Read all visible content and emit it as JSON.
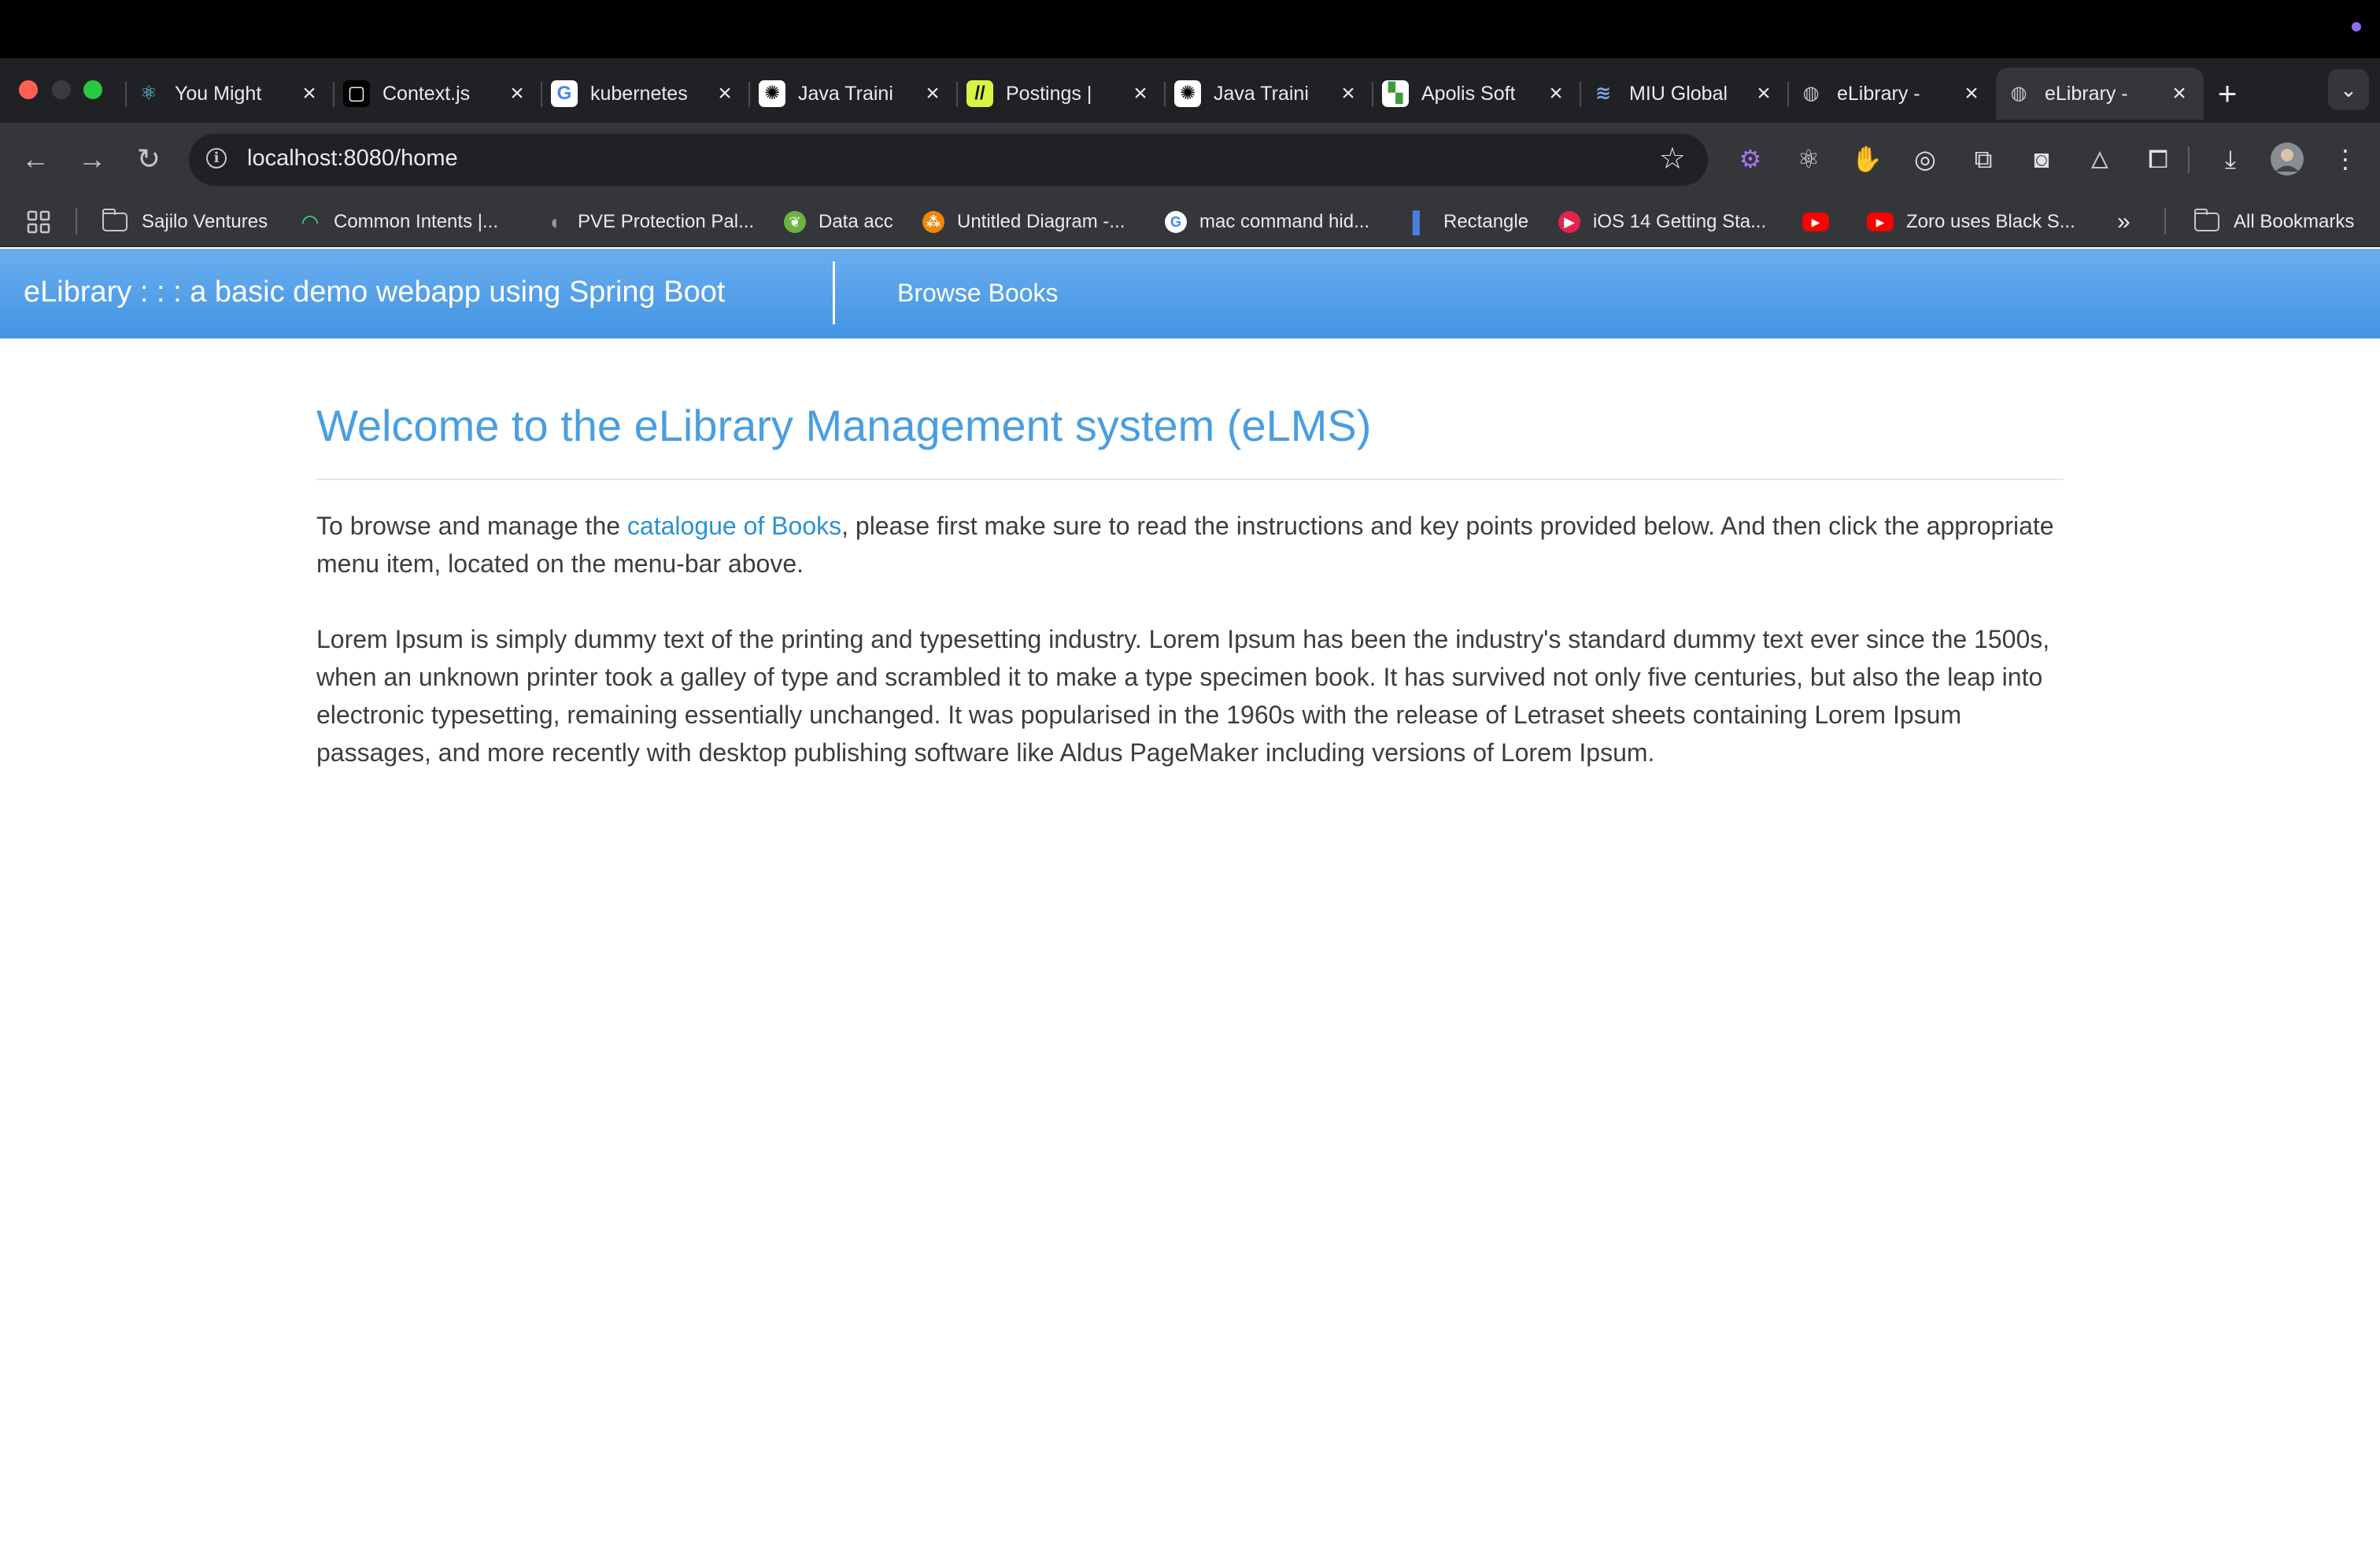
{
  "window": {
    "traffic_colors": [
      "#ff5f57",
      "#3b3b3d",
      "#28c840"
    ],
    "status_dot_color": "#8e6cf0"
  },
  "tabs": [
    {
      "title": "You Might",
      "icon": "react-icon",
      "glyph": "⚛",
      "fav_bg": "transparent",
      "fav_fg": "#61dafb",
      "active": false
    },
    {
      "title": "Context.js",
      "icon": "codesandbox-icon",
      "glyph": "▢",
      "fav_bg": "#000000",
      "fav_fg": "#ffffff",
      "active": false
    },
    {
      "title": "kubernetes",
      "icon": "google-icon",
      "glyph": "G",
      "fav_bg": "#ffffff",
      "fav_fg": "#4285f4",
      "active": false
    },
    {
      "title": "Java Traini",
      "icon": "chatgpt-icon",
      "glyph": "✺",
      "fav_bg": "#ffffff",
      "fav_fg": "#000000",
      "active": false
    },
    {
      "title": "Postings |",
      "icon": "handshake-icon",
      "glyph": "//",
      "fav_bg": "#d7f542",
      "fav_fg": "#111111",
      "active": false
    },
    {
      "title": "Java Traini",
      "icon": "chatgpt-icon",
      "glyph": "✺",
      "fav_bg": "#ffffff",
      "fav_fg": "#000000",
      "active": false
    },
    {
      "title": "Apolis Soft",
      "icon": "apolis-icon",
      "glyph": "▚",
      "fav_bg": "#ffffff",
      "fav_fg": "#3b9b3e",
      "active": false
    },
    {
      "title": "MIU Global",
      "icon": "miu-icon",
      "glyph": "≋",
      "fav_bg": "transparent",
      "fav_fg": "#7aa7e8",
      "active": false
    },
    {
      "title": "eLibrary -",
      "icon": "globe-icon",
      "glyph": "◍",
      "fav_bg": "transparent",
      "fav_fg": "#c4c7c5",
      "active": false
    },
    {
      "title": "eLibrary -",
      "icon": "globe-icon",
      "glyph": "◍",
      "fav_bg": "transparent",
      "fav_fg": "#c4c7c5",
      "active": true
    }
  ],
  "toolbar": {
    "url": "localhost:8080/home",
    "extensions": [
      {
        "icon": "gear-extension-icon",
        "glyph": "⚙",
        "color": "#a774f2"
      },
      {
        "icon": "react-devtools-icon",
        "glyph": "⚛",
        "color": "#dfe1e5"
      },
      {
        "icon": "hand-stop-icon",
        "glyph": "✋",
        "color": "#e8271b"
      },
      {
        "icon": "target-icon",
        "glyph": "◎",
        "color": "#dfe1e5"
      },
      {
        "icon": "screen-share-icon",
        "glyph": "⧉",
        "color": "#dfe1e5"
      },
      {
        "icon": "glasses-icon",
        "glyph": "◙",
        "color": "#dfe1e5"
      },
      {
        "icon": "angular-devtools-icon",
        "glyph": "▲",
        "color": "#2b2b2b"
      },
      {
        "icon": "puzzle-extensions-icon",
        "glyph": "⧠",
        "color": "#dfe1e5"
      }
    ]
  },
  "bookmarks": [
    {
      "label": "Sajilo Ventures",
      "icon": "folder-icon",
      "kind": "folder"
    },
    {
      "label": "Common Intents |...",
      "icon": "android-icon",
      "glyph": "◠",
      "bg": "transparent",
      "fg": "#3ddc84"
    },
    {
      "label": "PVE Protection Pal...",
      "icon": "pve-icon",
      "glyph": "◖",
      "bg": "transparent",
      "fg": "#9a9a9a"
    },
    {
      "label": "Data acc",
      "icon": "spring-icon",
      "glyph": "❦",
      "bg": "#6db33f",
      "fg": "#ffffff"
    },
    {
      "label": "Untitled Diagram -...",
      "icon": "drawio-icon",
      "glyph": "⁂",
      "bg": "#f08705",
      "fg": "#ffffff"
    },
    {
      "label": "mac command hid...",
      "icon": "google-icon",
      "glyph": "G",
      "bg": "#ffffff",
      "fg": "#4285f4"
    },
    {
      "label": "Rectangle",
      "icon": "rectangle-icon",
      "glyph": "▌",
      "bg": "transparent",
      "fg": "#4a7fe0"
    },
    {
      "label": "iOS 14 Getting Sta...",
      "icon": "ios-video-icon",
      "glyph": "▶",
      "bg": "#e8204c",
      "fg": "#ffffff"
    },
    {
      "label": "",
      "icon": "youtube-icon",
      "glyph": "▶",
      "bg": "#ff0000",
      "fg": "#ffffff"
    },
    {
      "label": "Zoro uses Black S...",
      "icon": "youtube-icon",
      "glyph": "▶",
      "bg": "#ff0000",
      "fg": "#ffffff"
    }
  ],
  "bookmarks_more": "»",
  "all_bookmarks": "All Bookmarks",
  "app": {
    "brand": "eLibrary : : : a basic demo webapp using Spring Boot",
    "nav_browse": "Browse Books"
  },
  "content": {
    "heading": "Welcome to the eLibrary Management system (eLMS)",
    "intro_before": "To browse and manage the ",
    "intro_link": "catalogue of Books",
    "intro_after": ", please first make sure to read the instructions and key points provided below. And then click the appropriate menu item, located on the menu-bar above.",
    "lorem": "Lorem Ipsum is simply dummy text of the printing and typesetting industry. Lorem Ipsum has been the industry's standard dummy text ever since the 1500s, when an unknown printer took a galley of type and scrambled it to make a type specimen book. It has survived not only five centuries, but also the leap into electronic typesetting, remaining essentially unchanged. It was popularised in the 1960s with the release of Letraset sheets containing Lorem Ipsum passages, and more recently with desktop publishing software like Aldus PageMaker including versions of Lorem Ipsum."
  }
}
